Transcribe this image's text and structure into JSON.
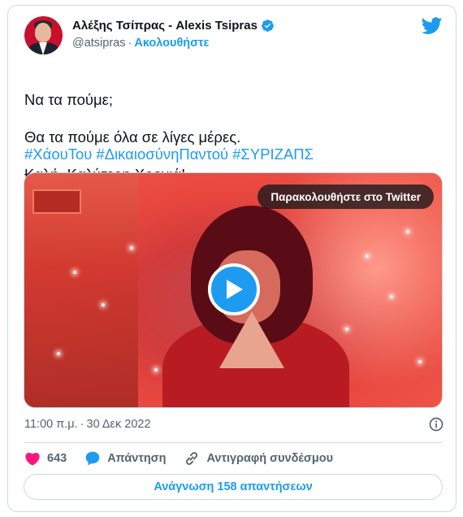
{
  "author": {
    "display_name": "Αλέξης Τσίπρας - Alexis Tsipras",
    "handle": "@atsipras",
    "separator": "·",
    "follow_label": "Ακολουθήστε"
  },
  "tweet": {
    "line1": "Να τα πούμε;",
    "line2": "Θα τα πούμε όλα σε λίγες μέρες.",
    "struck_word": "Καλή",
    "line3_rest": "Καλύτερη Χρονιά!",
    "hashtags": [
      "#ΧάουΤου",
      "#ΔικαιοσύνηΠαντού",
      "#ΣΥΡΙΖΑΠΣ"
    ]
  },
  "media": {
    "watch_label": "Παρακολουθήστε στο Twitter"
  },
  "meta": {
    "time": "11:00 π.μ.",
    "separator": "·",
    "date": "30 Δεκ 2022"
  },
  "actions": {
    "like_count": "643",
    "reply_label": "Απάντηση",
    "copy_link_label": "Αντιγραφή συνδέσμου"
  },
  "read_replies_label": "Ανάγνωση 158 απαντήσεων",
  "colors": {
    "accent": "#1d9bf0",
    "heart": "#f91880",
    "secondary_text": "#536471",
    "border": "#cfd9de"
  }
}
